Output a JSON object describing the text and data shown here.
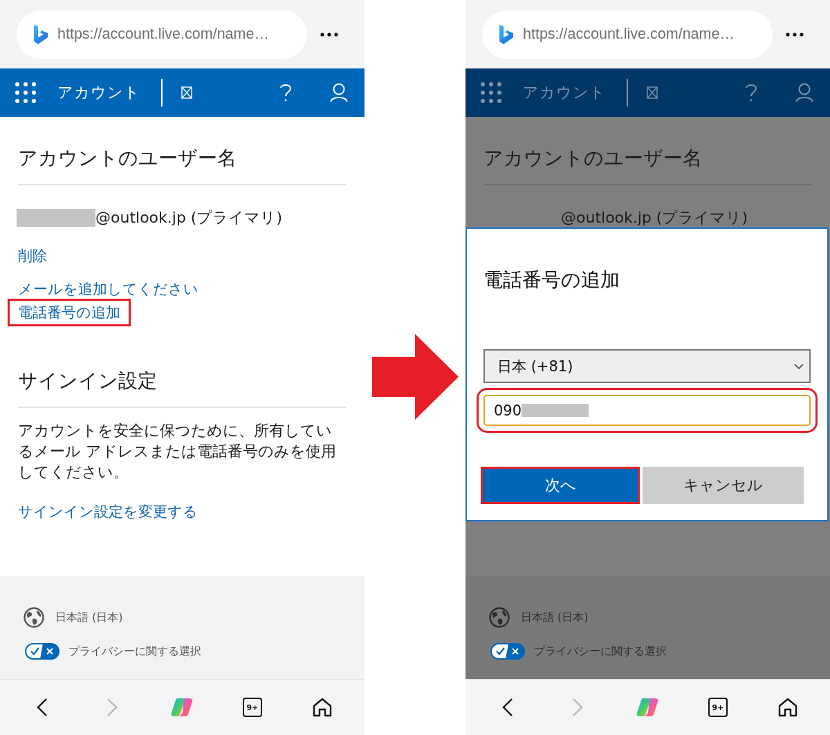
{
  "screens": [
    {
      "dimmed": false,
      "address_bar": {
        "url": "https://account.live.com/name…"
      },
      "header": {
        "title": "アカウント"
      },
      "sections": [
        {
          "title": "アカウントのユーザー名",
          "items": [
            {
              "kind": "email",
              "text": "@outlook.jp (プライマリ)",
              "redacted": true
            },
            {
              "kind": "link",
              "text": "削除",
              "highlighted": false
            },
            {
              "kind": "link",
              "text": "メールを追加してください",
              "highlighted": false
            },
            {
              "kind": "link",
              "text": "電話番号の追加",
              "highlighted": true
            }
          ]
        },
        {
          "title": "サインイン設定",
          "items": [
            {
              "kind": "paragraph",
              "text": "アカウントを安全に保つために、所有しているメール アドレスまたは電話番号のみを使用してください。"
            },
            {
              "kind": "link",
              "text": "サインイン設定を変更する",
              "highlighted": false
            }
          ]
        }
      ],
      "footer": {
        "language": "日本語 (日本)",
        "privacy": "プライバシーに関する選択"
      },
      "nav": [
        {
          "kind": "back",
          "disabled": false
        },
        {
          "kind": "forward",
          "disabled": true
        },
        {
          "kind": "assistant",
          "disabled": false
        },
        {
          "kind": "tabs",
          "label": "9+",
          "disabled": false
        },
        {
          "kind": "home",
          "disabled": false
        }
      ]
    },
    {
      "dimmed": true,
      "address_bar": {
        "url": "https://account.live.com/name…"
      },
      "header": {
        "title": "アカウント"
      },
      "sections": [
        {
          "title": "アカウントのユーザー名",
          "items": [
            {
              "kind": "email",
              "text": "@outlook.jp (プライマリ)",
              "redacted": false
            }
          ]
        }
      ],
      "dialog": {
        "title": "電話番号の追加",
        "country": "日本 (+81)",
        "phone": {
          "value": "090",
          "redacted": true,
          "highlighted": true
        },
        "buttons": [
          {
            "kind": "primary",
            "label": "次へ",
            "highlighted": true
          },
          {
            "kind": "secondary",
            "label": "キャンセル",
            "highlighted": false
          }
        ]
      },
      "footer": {
        "language": "日本語 (日本)",
        "privacy": "プライバシーに関する選択"
      },
      "nav": [
        {
          "kind": "back",
          "disabled": false
        },
        {
          "kind": "forward",
          "disabled": true
        },
        {
          "kind": "assistant",
          "disabled": false
        },
        {
          "kind": "tabs",
          "label": "9+",
          "disabled": false
        },
        {
          "kind": "home",
          "disabled": false
        }
      ]
    }
  ]
}
